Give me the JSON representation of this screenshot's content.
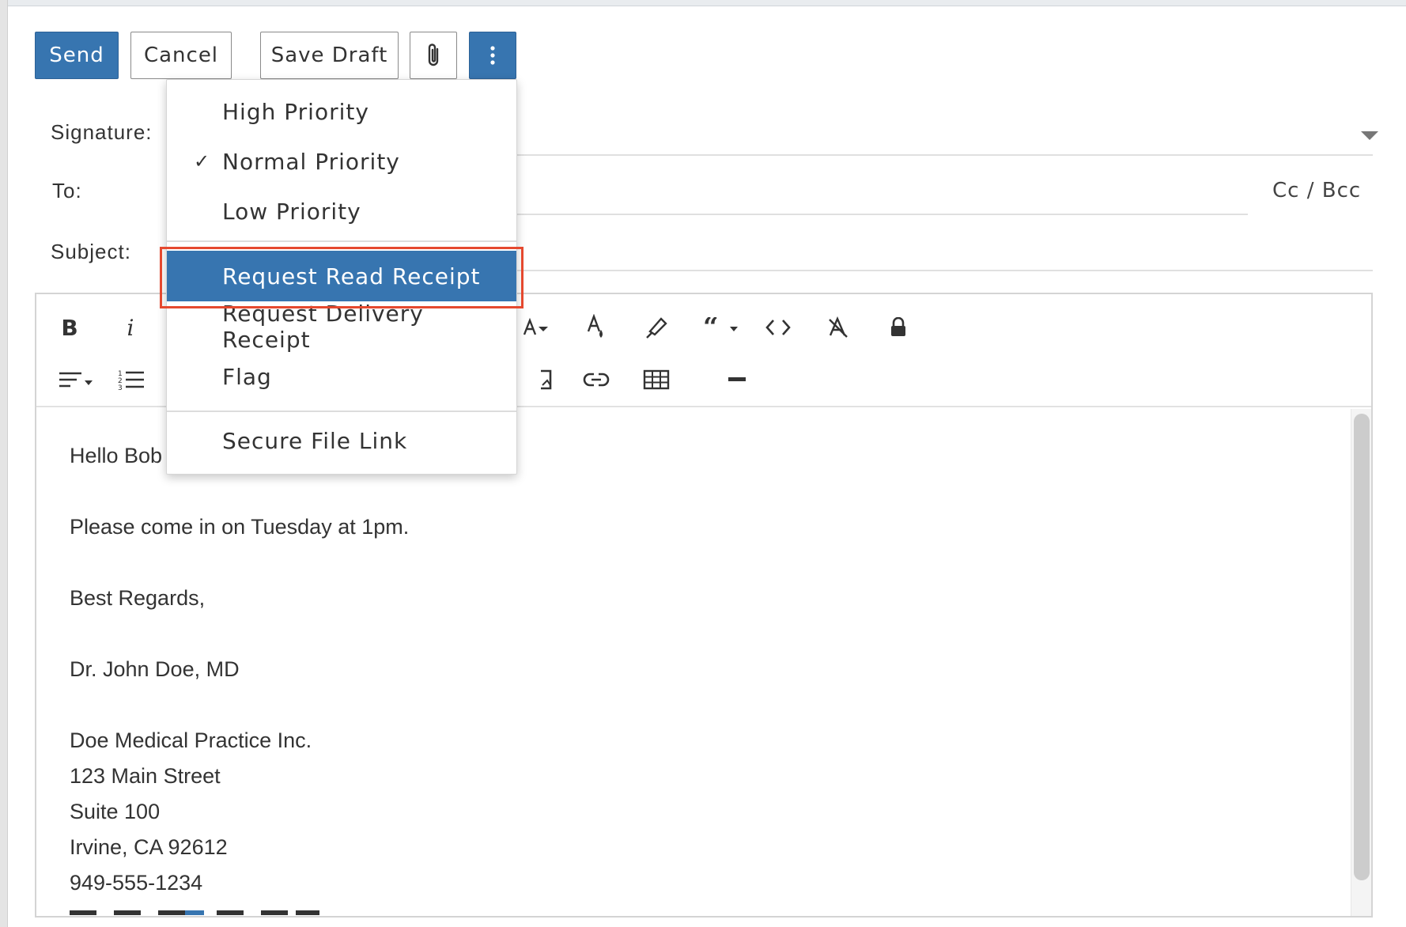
{
  "toolbar": {
    "send_label": "Send",
    "cancel_label": "Cancel",
    "save_draft_label": "Save Draft",
    "attach_icon": "paperclip-icon",
    "more_icon": "vertical-ellipsis-icon"
  },
  "form": {
    "signature_label": "Signature:",
    "to_label": "To:",
    "subject_label": "Subject:",
    "cc_bcc_label": "Cc / Bcc"
  },
  "editor_toolbar": {
    "bold": "B",
    "italic": "i"
  },
  "dropdown": {
    "items": [
      {
        "label": "High Priority",
        "checked": false
      },
      {
        "label": "Normal Priority",
        "checked": true
      },
      {
        "label": "Low Priority",
        "checked": false
      },
      {
        "label": "Request Read Receipt",
        "highlighted": true
      },
      {
        "label": "Request Delivery Receipt"
      },
      {
        "label": "Flag"
      },
      {
        "label": "Secure File Link"
      }
    ],
    "check_mark": "✓"
  },
  "body": {
    "greeting": "Hello Bob",
    "line1": "Please come in on Tuesday at 1pm.",
    "closing": "Best Regards,",
    "name": "Dr. John Doe, MD",
    "company": "Doe Medical Practice Inc.",
    "street": "123 Main Street",
    "suite": "Suite 100",
    "city": "Irvine, CA 92612",
    "phone": "949-555-1234"
  },
  "colors": {
    "primary": "#3775b0",
    "highlight_border": "#e5492f"
  }
}
